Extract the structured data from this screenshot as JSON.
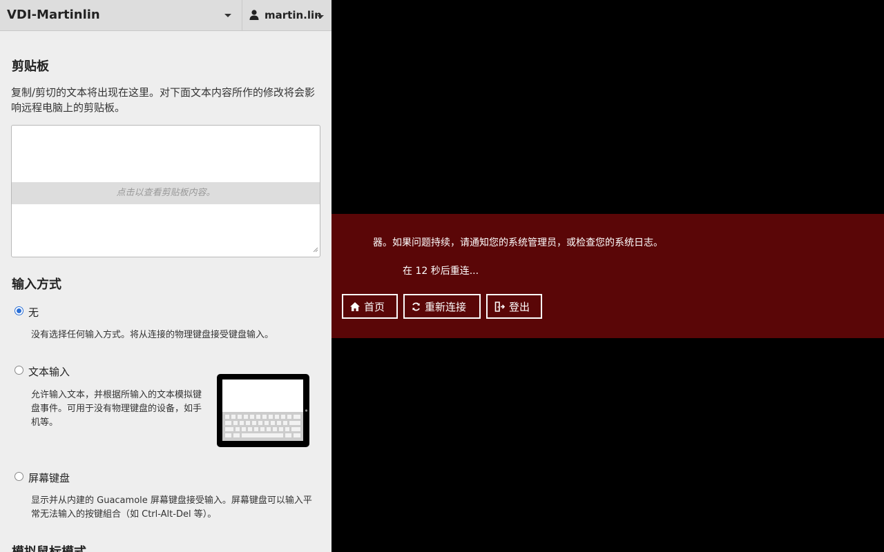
{
  "header": {
    "connection_name": "VDI-Martinlin",
    "username": "martin.lin"
  },
  "clipboard": {
    "title": "剪贴板",
    "description": "复制/剪切的文本将出现在这里。对下面文本内容所作的修改将会影响远程电脑上的剪贴板。",
    "hint": "点击以查看剪贴板内容。"
  },
  "input_method": {
    "title": "输入方式",
    "options": [
      {
        "label": "无",
        "description": "没有选择任何输入方式。将从连接的物理键盘接受键盘输入。",
        "selected": true
      },
      {
        "label": "文本输入",
        "description": "允许输入文本，并根据所输入的文本模拟键盘事件。可用于没有物理键盘的设备，如手机等。",
        "selected": false
      },
      {
        "label": "屏幕键盘",
        "description": "显示并从内建的 Guacamole 屏幕键盘接受输入。屏幕键盘可以输入平常无法输入的按键組合（如 Ctrl-Alt-Del 等）。",
        "selected": false
      }
    ]
  },
  "next_section": {
    "title": "模拟鼠标模式"
  },
  "error_dialog": {
    "message": "器。如果问题持续，请通知您的系统管理员，或检查您的系统日志。",
    "reconnect": "在 12 秒后重连...",
    "buttons": {
      "home": "首页",
      "reconnect": "重新连接",
      "logout": "登出"
    }
  },
  "colors": {
    "error_background": "#5a0607",
    "sidebar_background": "#eeeeee",
    "header_background": "#dddddd",
    "radio_accent": "#2a6fd6"
  },
  "icons": {
    "home": "home-icon",
    "reconnect": "reconnect-icon",
    "logout": "logout-icon",
    "user": "user-icon",
    "dropdown": "chevron-down-icon"
  }
}
